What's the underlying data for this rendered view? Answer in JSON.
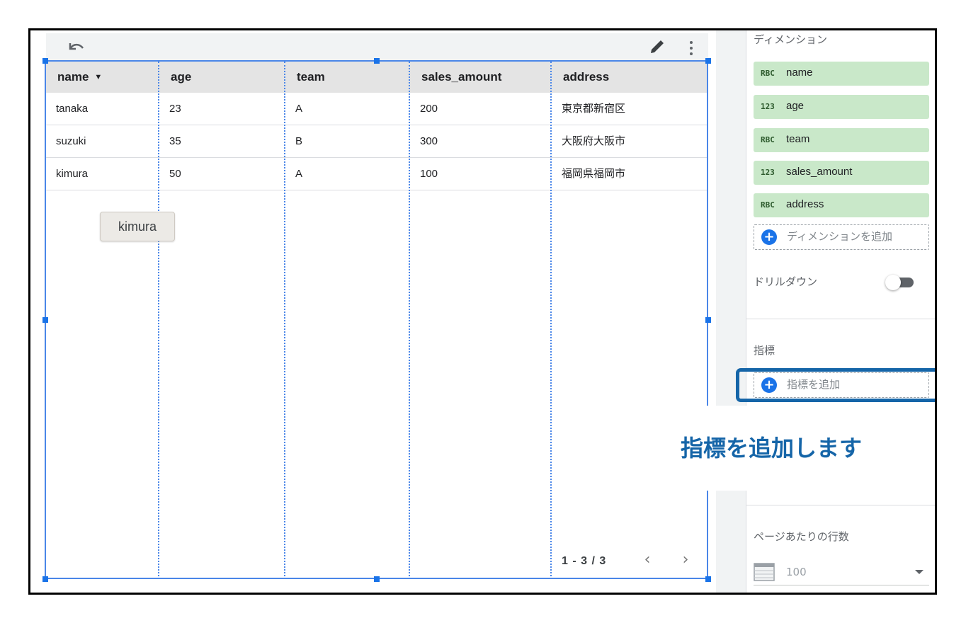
{
  "table": {
    "columns": [
      {
        "label": "name",
        "sort_indicator": "▼"
      },
      {
        "label": "age"
      },
      {
        "label": "team"
      },
      {
        "label": "sales_amount"
      },
      {
        "label": "address"
      }
    ],
    "rows": [
      [
        "tanaka",
        "23",
        "A",
        "200",
        "東京都新宿区"
      ],
      [
        "suzuki",
        "35",
        "B",
        "300",
        "大阪府大阪市"
      ],
      [
        "kimura",
        "50",
        "A",
        "100",
        "福岡県福岡市"
      ]
    ],
    "tooltip": "kimura",
    "pagination": "1 - 3 / 3",
    "prev": "‹",
    "next": "›"
  },
  "panel": {
    "dimension_title": "ディメンション",
    "dimensions": [
      {
        "type": "RBC",
        "label": "name"
      },
      {
        "type": "123",
        "label": "age"
      },
      {
        "type": "RBC",
        "label": "team"
      },
      {
        "type": "123",
        "label": "sales_amount"
      },
      {
        "type": "RBC",
        "label": "address"
      }
    ],
    "add_dimension": "ディメンションを追加",
    "drilldown": "ドリルダウン",
    "metric_title": "指標",
    "add_metric": "指標を追加",
    "rows_per_page_title": "ページあたりの行数",
    "rows_per_page_value": "100"
  },
  "annotation": {
    "callout": "指標を追加します",
    "color": "#1565a8"
  },
  "icons": [
    "undo-icon",
    "pencil-icon",
    "kebab-menu-icon",
    "plus-icon",
    "rows-icon",
    "caret-down-icon"
  ]
}
